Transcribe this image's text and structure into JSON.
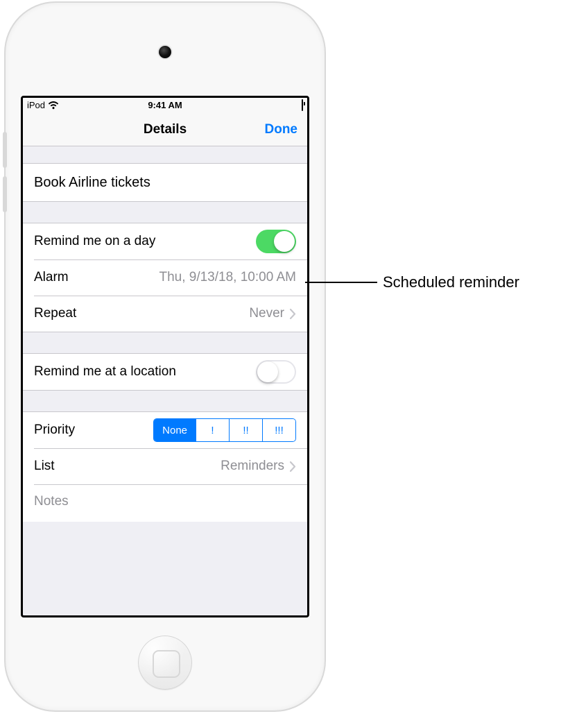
{
  "statusbar": {
    "carrier": "iPod",
    "time": "9:41 AM"
  },
  "nav": {
    "title": "Details",
    "done": "Done"
  },
  "reminder": {
    "title": "Book Airline tickets"
  },
  "schedule": {
    "remind_day_label": "Remind me on a day",
    "remind_day_on": true,
    "alarm_label": "Alarm",
    "alarm_value": "Thu, 9/13/18, 10:00 AM",
    "repeat_label": "Repeat",
    "repeat_value": "Never"
  },
  "location": {
    "label": "Remind me at a location",
    "on": false
  },
  "meta": {
    "priority_label": "Priority",
    "priority_selected": "None",
    "priority_options": [
      "None",
      "!",
      "!!",
      "!!!"
    ],
    "list_label": "List",
    "list_value": "Reminders",
    "notes_label": "Notes"
  },
  "callout": {
    "text": "Scheduled reminder"
  },
  "colors": {
    "tint": "#007aff",
    "switch_on": "#4cd964",
    "secondary_text": "#8e8e93",
    "background": "#efeff4",
    "separator": "#c8c7cc"
  }
}
